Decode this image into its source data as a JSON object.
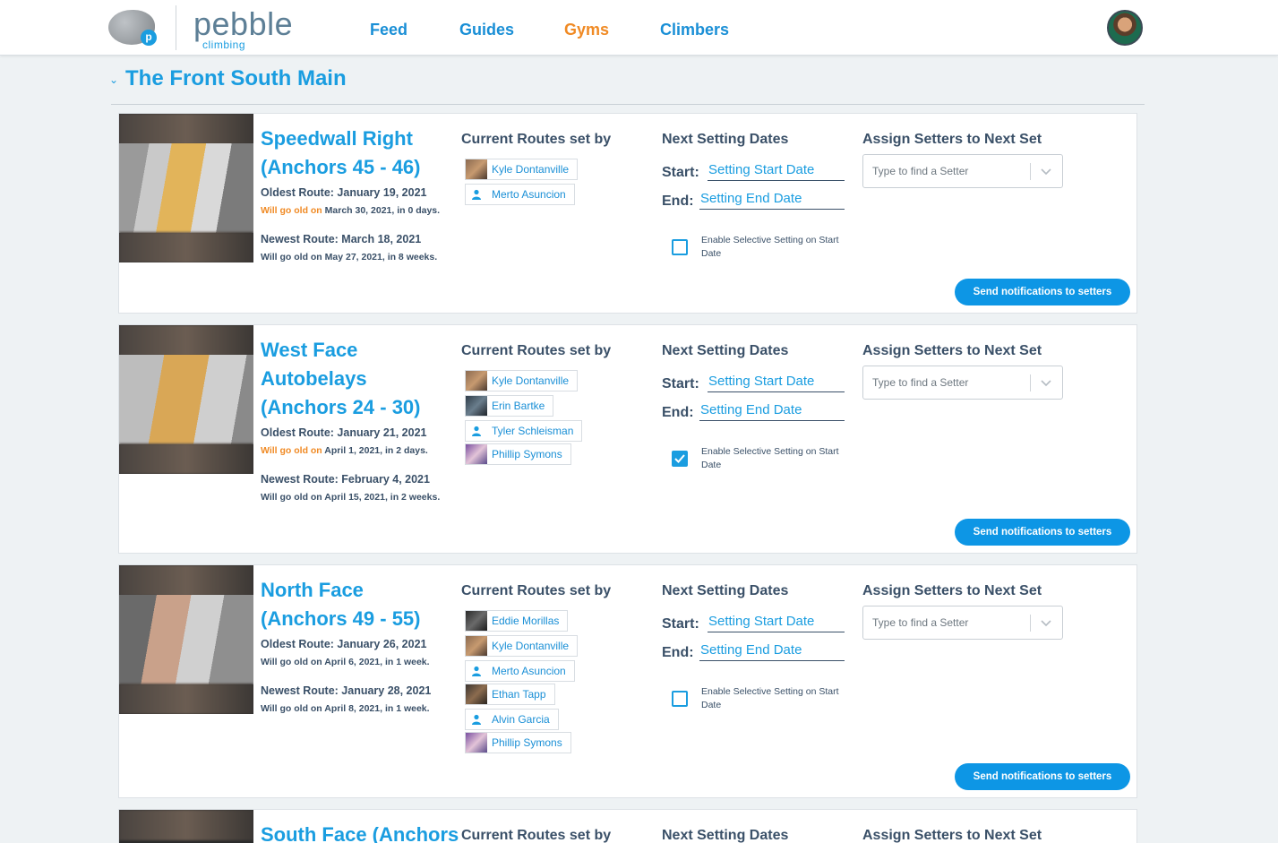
{
  "app": {
    "logo_word": "pebble",
    "logo_sub": "climbing",
    "logo_badge": "p"
  },
  "nav": {
    "items": [
      {
        "label": "Feed"
      },
      {
        "label": "Guides"
      },
      {
        "label": "Gyms",
        "active": true
      },
      {
        "label": "Climbers"
      }
    ]
  },
  "gym": {
    "title": "The Front South Main"
  },
  "labels": {
    "current_routes": "Current Routes set by",
    "next_dates": "Next Setting Dates",
    "assign": "Assign Setters to Next Set",
    "start": "Start:",
    "end": "End:",
    "start_placeholder": "Setting Start Date",
    "end_placeholder": "Setting End Date",
    "selective": "Enable Selective Setting on Start Date",
    "setter_placeholder": "Type to find a Setter",
    "notify_button": "Send notifications to setters",
    "will_go_old_on": "Will go old on"
  },
  "walls": [
    {
      "name": "Speedwall Right (Anchors 45 - 46)",
      "oldest": "Oldest Route: January 19, 2021",
      "oldest_sub_rest": "March 30, 2021, in 0 days.",
      "newest": "Newest Route: March 18, 2021",
      "newest_sub": "Will go old on May 27, 2021, in 8 weeks.",
      "selective_enabled": false,
      "setters": [
        "Kyle Dontanville",
        "Merto Asuncion"
      ]
    },
    {
      "name": "West Face Autobelays (Anchors 24 - 30)",
      "oldest": "Oldest Route: January 21, 2021",
      "oldest_sub_rest": "April 1, 2021, in 2 days.",
      "newest": "Newest Route: February 4, 2021",
      "newest_sub": "Will go old on April 15, 2021, in 2 weeks.",
      "selective_enabled": true,
      "setters": [
        "Kyle Dontanville",
        "Erin Bartke",
        "Tyler Schleisman",
        "Phillip Symons"
      ]
    },
    {
      "name": "North Face (Anchors 49 - 55)",
      "oldest": "Oldest Route: January 26, 2021",
      "oldest_sub": "Will go old on April 6, 2021, in 1 week.",
      "newest": "Newest Route: January 28, 2021",
      "newest_sub": "Will go old on April 8, 2021, in 1 week.",
      "selective_enabled": false,
      "setters": [
        "Eddie Morillas",
        "Kyle Dontanville",
        "Merto Asuncion",
        "Ethan Tapp",
        "Alvin Garcia",
        "Phillip Symons"
      ]
    },
    {
      "name": "South Face (Anchors"
    }
  ],
  "colors": {
    "brand_blue": "#1a9de0",
    "active_nav": "#f08a24",
    "button_blue": "#0d96e5",
    "warning": "#f08a24"
  }
}
